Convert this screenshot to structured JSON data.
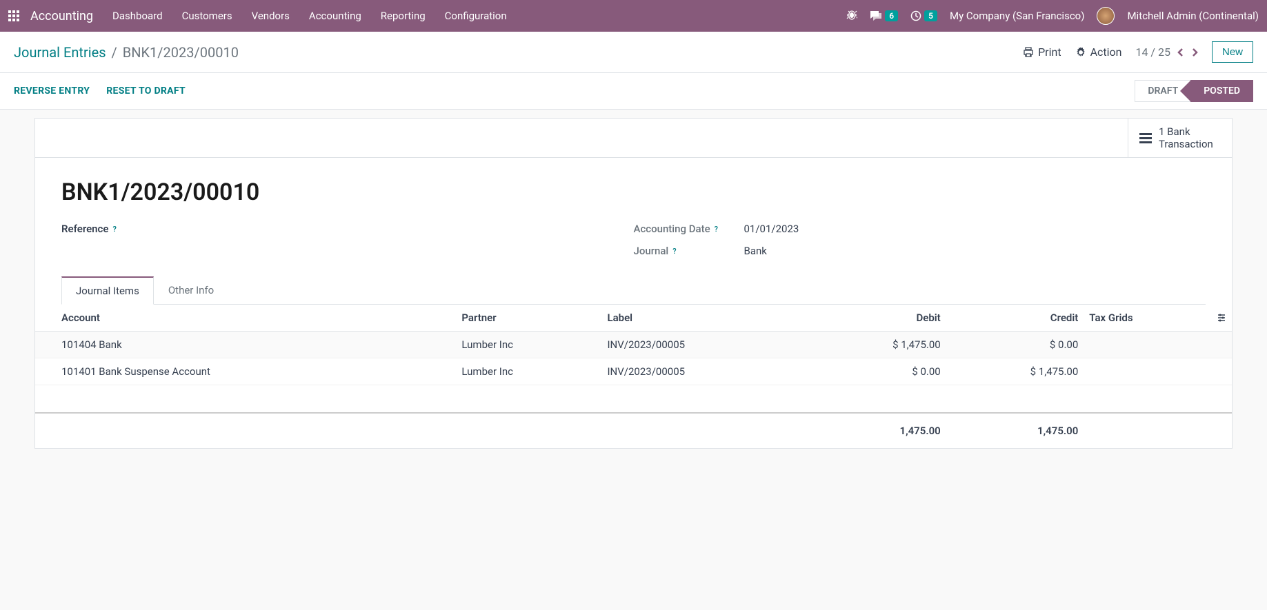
{
  "nav": {
    "app": "Accounting",
    "menu": [
      "Dashboard",
      "Customers",
      "Vendors",
      "Accounting",
      "Reporting",
      "Configuration"
    ],
    "chat_badge": "6",
    "activity_badge": "5",
    "company": "My Company (San Francisco)",
    "user": "Mitchell Admin (Continental)"
  },
  "breadcrumb": {
    "parent": "Journal Entries",
    "current": "BNK1/2023/00010",
    "print": "Print",
    "action": "Action",
    "pager": "14 / 25",
    "new": "New"
  },
  "status": {
    "reverse": "REVERSE ENTRY",
    "reset": "RESET TO DRAFT",
    "draft": "DRAFT",
    "posted": "POSTED"
  },
  "smart": {
    "bank_trans": "1 Bank Transaction"
  },
  "record": {
    "title": "BNK1/2023/00010",
    "reference_label": "Reference",
    "reference_value": "",
    "date_label": "Accounting Date",
    "date_value": "01/01/2023",
    "journal_label": "Journal",
    "journal_value": "Bank"
  },
  "tabs": {
    "items": "Journal Items",
    "other": "Other Info"
  },
  "table": {
    "headers": {
      "account": "Account",
      "partner": "Partner",
      "label": "Label",
      "debit": "Debit",
      "credit": "Credit",
      "tax": "Tax Grids"
    },
    "rows": [
      {
        "account": "101404 Bank",
        "partner": "Lumber Inc",
        "label": "INV/2023/00005",
        "debit": "$ 1,475.00",
        "credit": "$ 0.00",
        "tax": ""
      },
      {
        "account": "101401 Bank Suspense Account",
        "partner": "Lumber Inc",
        "label": "INV/2023/00005",
        "debit": "$ 0.00",
        "credit": "$ 1,475.00",
        "tax": ""
      }
    ],
    "totals": {
      "debit": "1,475.00",
      "credit": "1,475.00"
    }
  }
}
